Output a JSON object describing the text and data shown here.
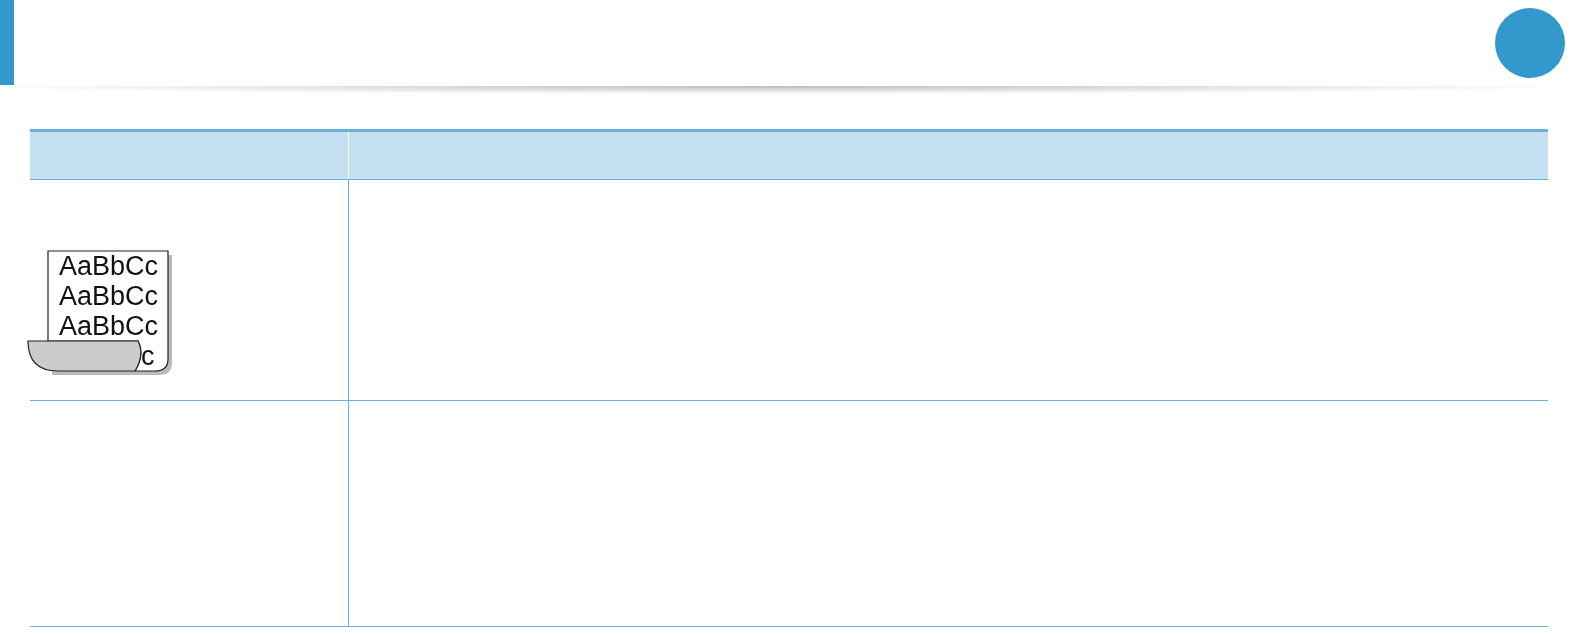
{
  "table": {
    "rows": [
      {
        "kind": "illustration",
        "sample_lines": [
          "AaBbCc",
          "AaBbCc",
          "AaBbCc"
        ],
        "curl_text": "c"
      },
      {
        "kind": "empty"
      }
    ]
  }
}
